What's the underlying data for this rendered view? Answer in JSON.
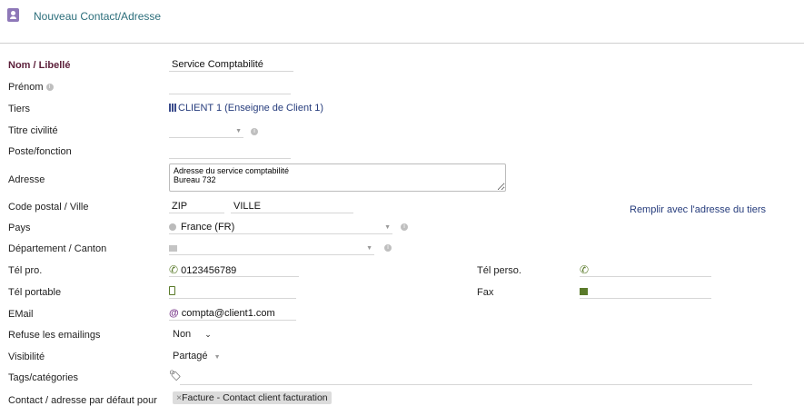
{
  "header": {
    "title": "Nouveau Contact/Adresse",
    "icon": "contact-card-icon"
  },
  "form": {
    "nom": {
      "label": "Nom / Libellé",
      "value": "Service Comptabilité"
    },
    "prenom": {
      "label": "Prénom",
      "value": ""
    },
    "tiers": {
      "label": "Tiers",
      "value": "CLIENT 1 (Enseigne de Client 1)"
    },
    "titre": {
      "label": "Titre civilité",
      "value": ""
    },
    "poste": {
      "label": "Poste/fonction",
      "value": ""
    },
    "adresse": {
      "label": "Adresse",
      "value": "Adresse du service comptabilité\nBureau 732"
    },
    "cp": {
      "label": "Code postal / Ville",
      "zip": "ZIP",
      "ville": "VILLE",
      "fill_link": "Remplir avec l'adresse du tiers"
    },
    "pays": {
      "label": "Pays",
      "value": "France (FR)"
    },
    "departement": {
      "label": "Département / Canton",
      "value": ""
    },
    "tel_pro": {
      "label": "Tél pro.",
      "value": "0123456789"
    },
    "tel_perso": {
      "label": "Tél perso.",
      "value": ""
    },
    "tel_portable": {
      "label": "Tél portable",
      "value": ""
    },
    "fax": {
      "label": "Fax",
      "value": ""
    },
    "email": {
      "label": "EMail",
      "value": "compta@client1.com"
    },
    "refuse": {
      "label": "Refuse les emailings",
      "value": "Non"
    },
    "visibilite": {
      "label": "Visibilité",
      "value": "Partagé"
    },
    "tags": {
      "label": "Tags/catégories"
    },
    "defaut": {
      "label": "Contact / adresse par défaut pour",
      "tag": "Facture - Contact client facturation",
      "tag_remove": "×"
    }
  },
  "colors": {
    "accent": "#2c6e7b",
    "label_bold": "#5c1f3a",
    "link": "#263c7c",
    "icon": "#8e78b8"
  }
}
